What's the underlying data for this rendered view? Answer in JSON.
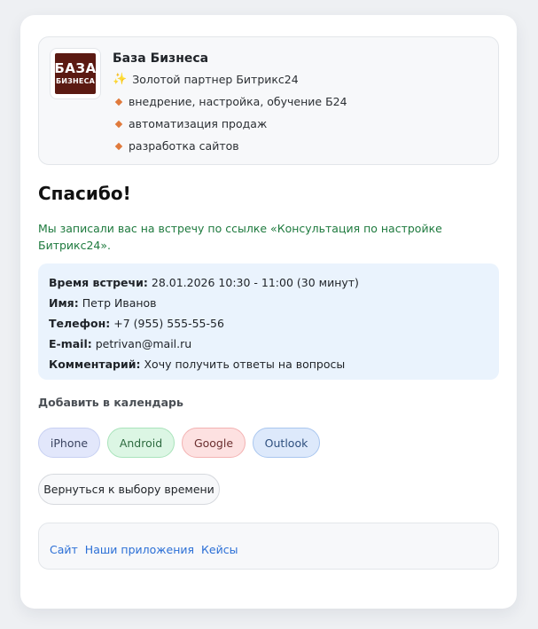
{
  "company": {
    "logo_line1": "БАЗА",
    "logo_line2": "БИЗНЕСА",
    "name": "База Бизнеса",
    "partner_icon": "sparkle-icon",
    "partner": "Золотой партнер Битрикс24",
    "services": [
      "внедрение, настройка, обучение Б24",
      "автоматизация продаж",
      "разработка сайтов"
    ]
  },
  "confirmation": {
    "title": "Спасибо!",
    "message": "Мы записали вас на встречу по ссылке «Консультация по настройке Битрикс24»."
  },
  "details": {
    "time_label": "Время встречи:",
    "time_value": "28.01.2026 10:30 - 11:00 (30 минут)",
    "name_label": "Имя:",
    "name_value": "Петр Иванов",
    "phone_label": "Телефон:",
    "phone_value": "+7 (955) 555-55-56",
    "email_label": "E-mail:",
    "email_value": "petrivan@mail.ru",
    "comment_label": "Комментарий:",
    "comment_value": "Хочу получить ответы на вопросы"
  },
  "calendar": {
    "title": "Добавить в календарь",
    "buttons": [
      "iPhone",
      "Android",
      "Google",
      "Outlook"
    ]
  },
  "back_button": "Вернуться к выбору времени",
  "footer": {
    "links": [
      "Сайт",
      "Наши приложения",
      "Кейсы"
    ]
  },
  "colors": {
    "accent_link": "#2b6fd6",
    "success_text": "#1e7a3e",
    "details_bg": "#eaf3fd",
    "logo_bg": "#5b1a12"
  }
}
